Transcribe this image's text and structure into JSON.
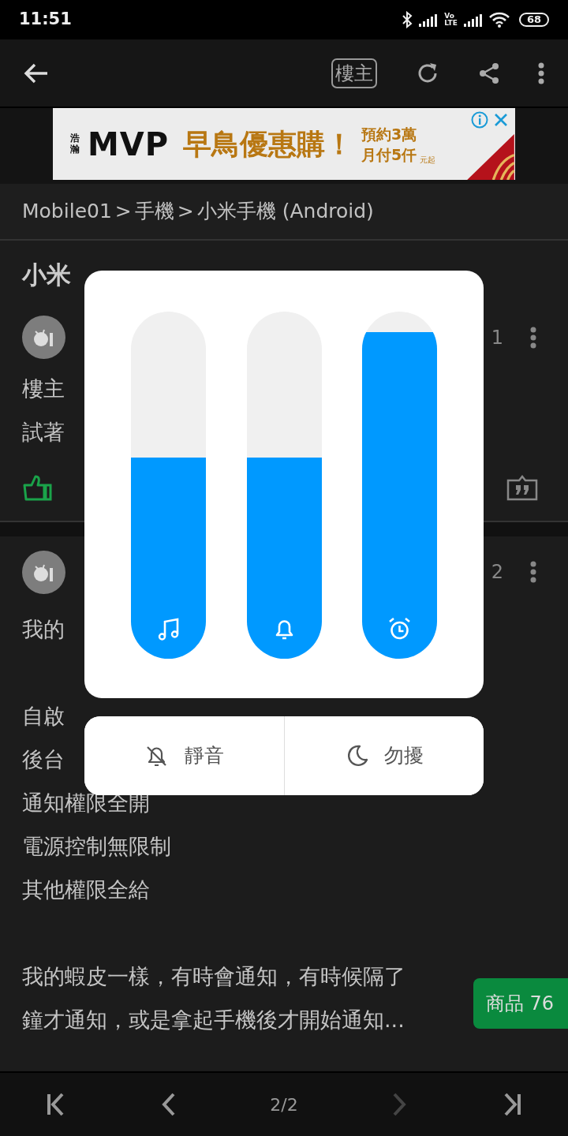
{
  "status_bar": {
    "time": "11:51",
    "volte_top": "Vo",
    "volte_bottom": "LTE",
    "battery": "68"
  },
  "toolbar": {
    "op_button": "樓主"
  },
  "ad": {
    "brand_vertical": "浩瀚",
    "brand": "MVP",
    "headline": "早鳥優惠購！",
    "line_1": "預約3萬",
    "line_2": "月付5仟",
    "fine_print": "元起"
  },
  "breadcrumb": [
    {
      "label": "Mobile01"
    },
    {
      "label": "手機"
    },
    {
      "label": "小米手機 (Android)"
    }
  ],
  "breadcrumb_separator": ">",
  "thread_title": "小米",
  "posts": [
    {
      "floor": "1",
      "paragraphs": [
        [
          "樓主",
          "試著"
        ]
      ],
      "actions": true
    },
    {
      "floor": "2",
      "paragraphs": [
        [
          "我的"
        ],
        [
          "自啟",
          "後台",
          "通知權限全開",
          "電源控制無限制",
          "其他權限全給"
        ],
        [
          "我的蝦皮一樣，有時會通知，有時候隔了",
          "鐘才通知，或是拿起手機後才開始通知..."
        ]
      ],
      "actions": false
    }
  ],
  "product_badge": "商品 76",
  "pager": {
    "page": "2/2",
    "buttons": [
      {
        "kind": "first",
        "disabled": false
      },
      {
        "kind": "prev",
        "disabled": false
      },
      {
        "kind": "next",
        "disabled": true
      },
      {
        "kind": "last",
        "disabled": false
      }
    ]
  },
  "volume_panel": {
    "sliders": [
      {
        "kind": "media",
        "level": 0.58
      },
      {
        "kind": "ring",
        "level": 0.58
      },
      {
        "kind": "alarm",
        "level": 0.94
      }
    ],
    "buttons": [
      {
        "kind": "mute",
        "label": "靜音"
      },
      {
        "kind": "dnd",
        "label": "勿擾"
      }
    ]
  }
}
